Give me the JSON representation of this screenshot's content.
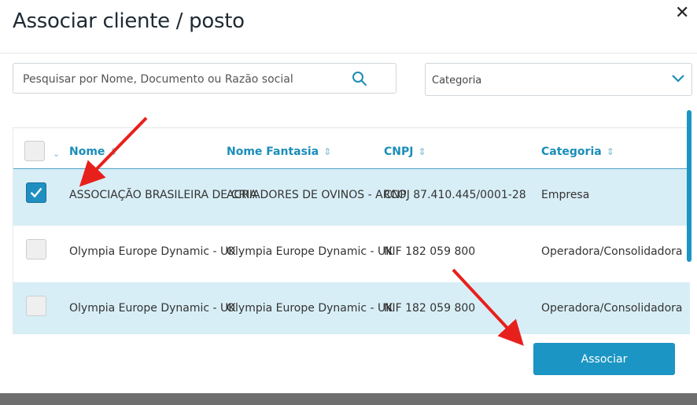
{
  "dialog": {
    "title": "Associar cliente / posto",
    "close_glyph": "✕"
  },
  "search": {
    "placeholder": "Pesquisar por Nome, Documento ou Razão social"
  },
  "category_select": {
    "value": "Categoria"
  },
  "table": {
    "columns": [
      "Nome",
      "Nome Fantasia",
      "CNPJ",
      "Categoria"
    ],
    "sort_glyph": "⌃",
    "rows": [
      {
        "checked": true,
        "nome": "ASSOCIAÇÃO BRASILEIRA DE CRIA",
        "fantasia": "ACRIADORES DE OVINOS - ARCO",
        "cnpj": "CNPJ 87.410.445/0001-28",
        "categoria": "Empresa"
      },
      {
        "checked": false,
        "nome": "Olympia Europe Dynamic - UK",
        "fantasia": "Olympia Europe Dynamic - UK",
        "cnpj": "NIF 182 059 800",
        "categoria": "Operadora/Consolidadora"
      },
      {
        "checked": false,
        "nome": "Olympia Europe Dynamic - UK",
        "fantasia": "Olympia Europe Dynamic - UK",
        "cnpj": "NIF 182 059 800",
        "categoria": "Operadora/Consolidadora"
      }
    ]
  },
  "footer": {
    "associate_label": "Associar"
  },
  "colors": {
    "accent": "#1b95c4",
    "selected_row": "#d8eef6",
    "annotation_arrow": "#e8201c"
  },
  "icons": {
    "search": "search-icon",
    "chevron": "chevron-down-icon",
    "close": "close-icon"
  }
}
